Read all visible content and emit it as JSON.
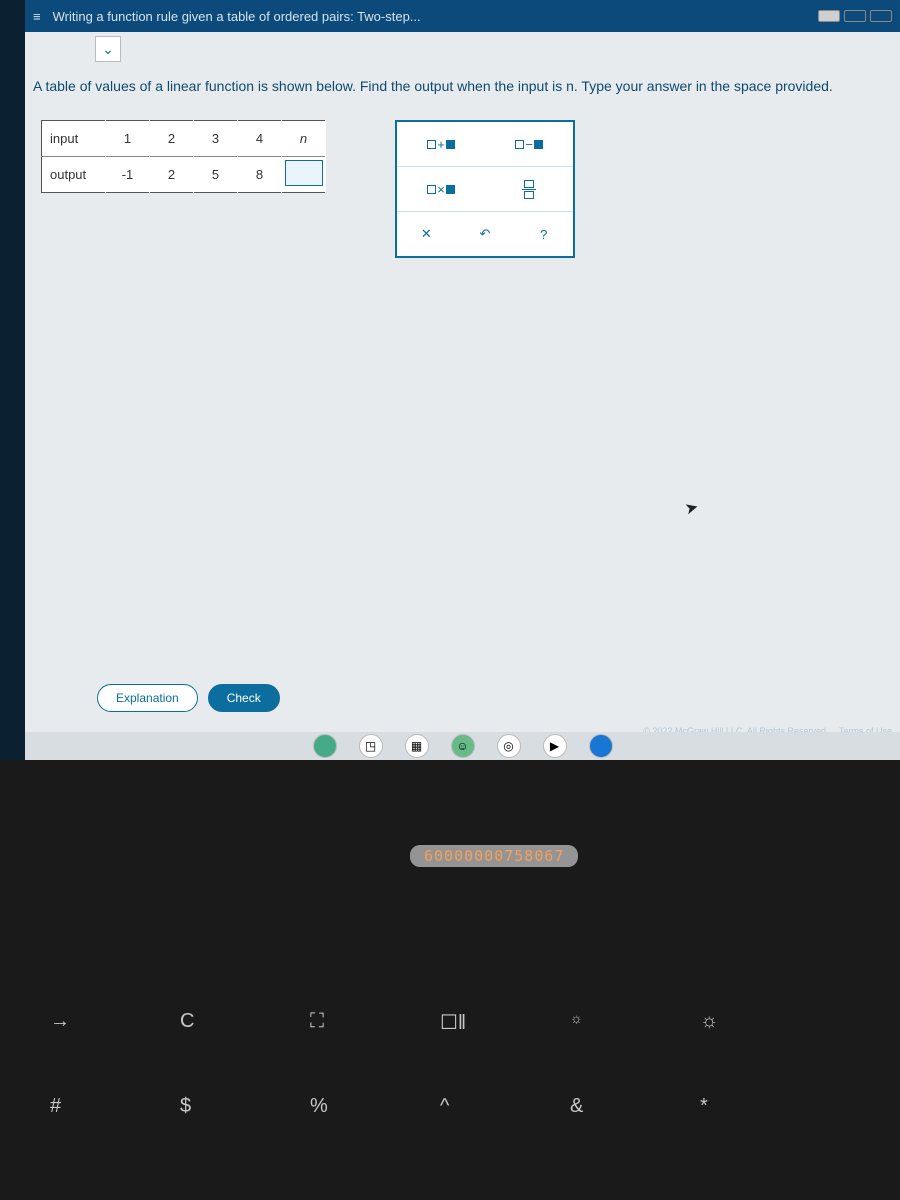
{
  "titlebar": {
    "title": "Writing a function rule given a table of ordered pairs: Two-step..."
  },
  "prompt_text": "A table of values of a linear function is shown below. Find the output when the input is n. Type your answer in the space provided.",
  "table": {
    "row_input_label": "input",
    "row_output_label": "output",
    "inputs": [
      "1",
      "2",
      "3",
      "4",
      "n"
    ],
    "outputs": [
      "-1",
      "2",
      "5",
      "8",
      ""
    ]
  },
  "toolbox": {
    "add": "☐+",
    "sub": "☐−",
    "mul": "☐×",
    "frac": "frac",
    "close": "✕",
    "undo": "↶",
    "help": "?"
  },
  "buttons": {
    "explanation": "Explanation",
    "check": "Check"
  },
  "footer": {
    "copyright": "© 2022 McGraw Hill LLC. All Rights Reserved.",
    "terms": "Terms of Use"
  },
  "id_badge": "60000000758067",
  "keyboard": {
    "arrow": "→",
    "refresh": "C",
    "hash": "#",
    "dollar": "$",
    "fullscreen": "⛶",
    "percent": "%",
    "windows": "☐‖",
    "caret": "^",
    "brightdown": "☼",
    "amp": "&",
    "brightup": "☼",
    "star": "*"
  }
}
